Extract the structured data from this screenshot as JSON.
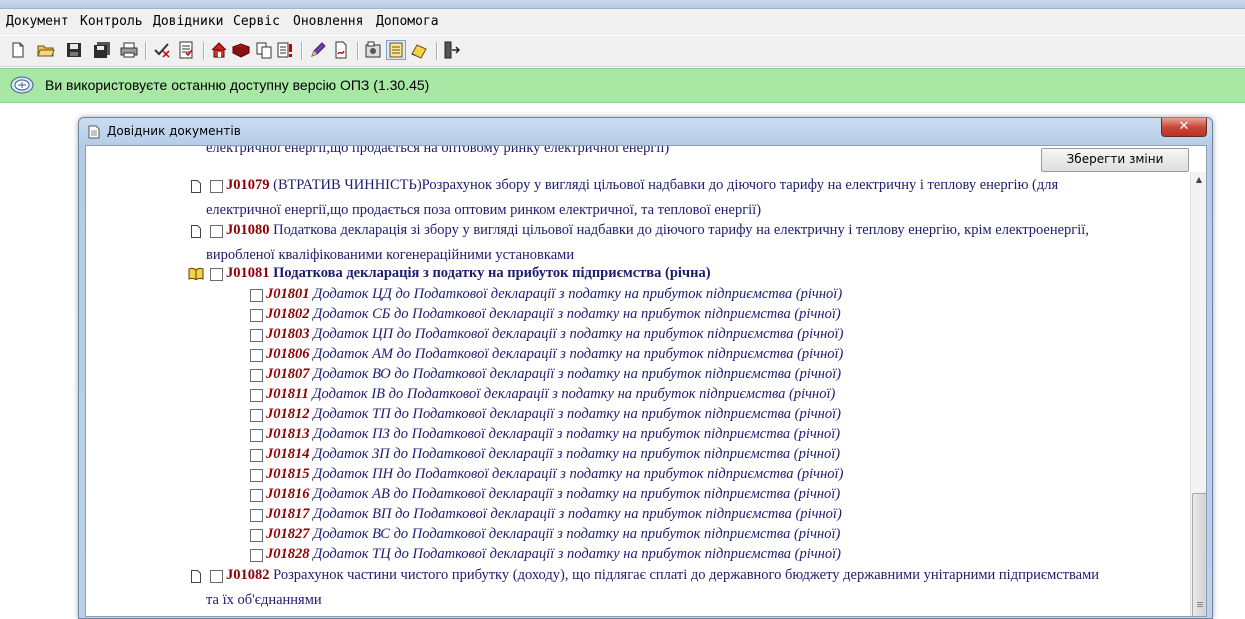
{
  "menu": [
    "Документ",
    "Контроль",
    "Довідники",
    "Сервіс",
    "Оновлення",
    "Допомога"
  ],
  "info": {
    "message": "Ви використовуєте останню доступну версію ОПЗ (1.30.45)"
  },
  "window": {
    "title": "Довідник документів",
    "close": "✕",
    "save_label": "Зберегти зміни"
  },
  "docs": [
    {
      "top_fragment": "електричної енергії,що продається на оптовому ринку електричної енергії)"
    },
    {
      "code": "J01079",
      "text1": "(ВТРАТИВ ЧИННІСТЬ)Розрахунок збору у вигляді цільової надбавки до діючого тарифу на електричну і теплову енергію (для",
      "text2": "електричної енергії,що продається поза оптовим ринком електричної, та теплової енергії)"
    },
    {
      "code": "J01080",
      "text1": "Податкова декларація зі збору у вигляді цільової надбавки до діючого тарифу на електричну і теплову енергію, крім електроенергії,",
      "text2": "виробленої кваліфікованими когенераційними установками"
    },
    {
      "code": "J01081",
      "text1": "Податкова декларація з податку на прибуток підприємства (річна)"
    },
    {
      "code": "J01082",
      "text1": "Розрахунок частини чистого прибутку (доходу), що підлягає сплаті до державного бюджету державними унітарними підприємствами",
      "text2": "та їх об'єднаннями"
    }
  ],
  "attachments": [
    {
      "code": "J01801",
      "text": "Додаток ЦД до Податкової декларації з податку на прибуток підприємства (річної)"
    },
    {
      "code": "J01802",
      "text": "Додаток СБ до Податкової декларації з податку на прибуток підприємства (річної)"
    },
    {
      "code": "J01803",
      "text": "Додаток ЦП до Податкової декларації з податку на прибуток підприємства (річної)"
    },
    {
      "code": "J01806",
      "text": "Додаток АМ до Податкової декларації з податку на прибуток підприємства (річної)"
    },
    {
      "code": "J01807",
      "text": "Додаток ВО до Податкової декларації з податку на прибуток підприємства (річної)"
    },
    {
      "code": "J01811",
      "text": "Додаток ІВ до Податкової декларації з податку на прибуток підприємства (річної)"
    },
    {
      "code": "J01812",
      "text": "Додаток ТП до Податкової декларації з податку на прибуток підприємства (річної)"
    },
    {
      "code": "J01813",
      "text": "Додаток ПЗ до Податкової декларації з податку на прибуток підприємства (річної)"
    },
    {
      "code": "J01814",
      "text": "Додаток ЗП до Податкової декларації з податку на прибуток підприємства (річної)"
    },
    {
      "code": "J01815",
      "text": "Додаток ПН до Податкової декларації з податку на прибуток підприємства (річної)"
    },
    {
      "code": "J01816",
      "text": "Додаток АВ до Податкової декларації з податку на прибуток підприємства (річної)"
    },
    {
      "code": "J01817",
      "text": "Додаток ВП до Податкової декларації з податку на прибуток підприємства (річної)"
    },
    {
      "code": "J01827",
      "text": "Додаток ВС до Податкової декларації з податку на прибуток підприємства (річної)"
    },
    {
      "code": "J01828",
      "text": "Додаток ТЦ до Податкової декларації з податку на прибуток підприємства (річної)"
    }
  ],
  "icons": [
    "new-file-icon",
    "open-folder-icon",
    "save-icon",
    "save-all-icon",
    "print-icon",
    "check-icon",
    "check-list-icon",
    "home-icon",
    "book-icon",
    "copy-icon",
    "report-icon",
    "pen-icon",
    "doc-red-icon",
    "settings-icon",
    "list-icon",
    "pen-yellow-icon",
    "exit-icon"
  ]
}
